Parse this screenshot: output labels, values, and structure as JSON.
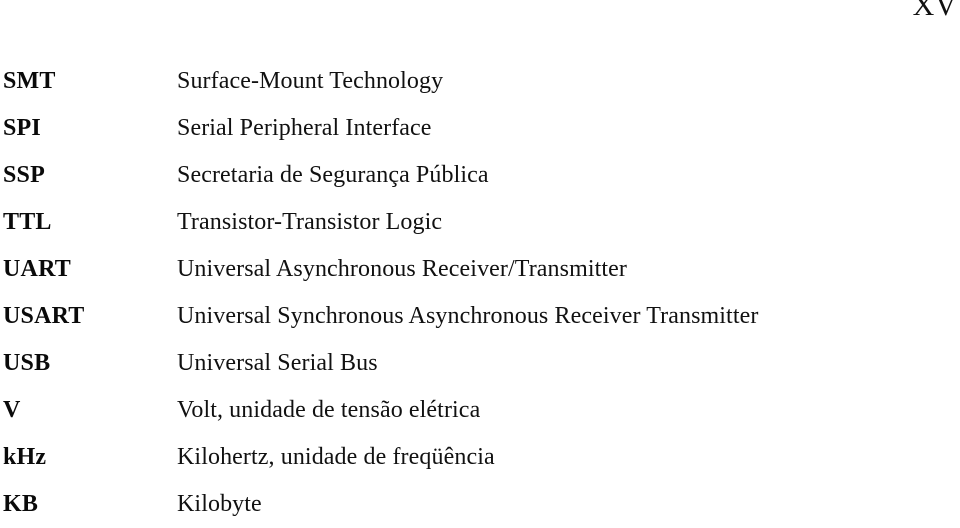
{
  "page": {
    "folio": "XV",
    "background_color": "#ffffff",
    "text_color": "#111111"
  },
  "abbreviations": {
    "column_headers": {
      "term": "",
      "definition": ""
    },
    "rows": [
      {
        "term": "SMT",
        "definition": "Surface-Mount Technology"
      },
      {
        "term": "SPI",
        "definition": "Serial Peripheral Interface"
      },
      {
        "term": "SSP",
        "definition": "Secretaria de Segurança Pública"
      },
      {
        "term": "TTL",
        "definition": "Transistor-Transistor Logic"
      },
      {
        "term": "UART",
        "definition": "Universal Asynchronous Receiver/Transmitter"
      },
      {
        "term": "USART",
        "definition": "Universal Synchronous Asynchronous Receiver Transmitter"
      },
      {
        "term": "USB",
        "definition": "Universal Serial Bus"
      },
      {
        "term": "V",
        "definition": "Volt, unidade de tensão elétrica"
      },
      {
        "term": "kHz",
        "definition": "Kilohertz, unidade de freqüência"
      },
      {
        "term": "KB",
        "definition": "Kilobyte"
      }
    ]
  }
}
